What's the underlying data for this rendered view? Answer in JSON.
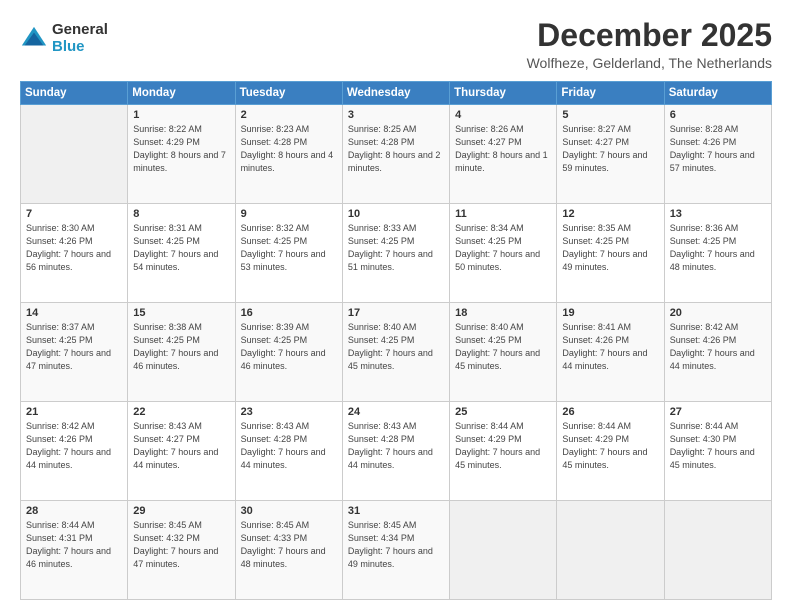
{
  "logo": {
    "general": "General",
    "blue": "Blue"
  },
  "header": {
    "month": "December 2025",
    "location": "Wolfheze, Gelderland, The Netherlands"
  },
  "weekdays": [
    "Sunday",
    "Monday",
    "Tuesday",
    "Wednesday",
    "Thursday",
    "Friday",
    "Saturday"
  ],
  "weeks": [
    [
      {
        "day": "",
        "sunrise": "",
        "sunset": "",
        "daylight": ""
      },
      {
        "day": "1",
        "sunrise": "Sunrise: 8:22 AM",
        "sunset": "Sunset: 4:29 PM",
        "daylight": "Daylight: 8 hours and 7 minutes."
      },
      {
        "day": "2",
        "sunrise": "Sunrise: 8:23 AM",
        "sunset": "Sunset: 4:28 PM",
        "daylight": "Daylight: 8 hours and 4 minutes."
      },
      {
        "day": "3",
        "sunrise": "Sunrise: 8:25 AM",
        "sunset": "Sunset: 4:28 PM",
        "daylight": "Daylight: 8 hours and 2 minutes."
      },
      {
        "day": "4",
        "sunrise": "Sunrise: 8:26 AM",
        "sunset": "Sunset: 4:27 PM",
        "daylight": "Daylight: 8 hours and 1 minute."
      },
      {
        "day": "5",
        "sunrise": "Sunrise: 8:27 AM",
        "sunset": "Sunset: 4:27 PM",
        "daylight": "Daylight: 7 hours and 59 minutes."
      },
      {
        "day": "6",
        "sunrise": "Sunrise: 8:28 AM",
        "sunset": "Sunset: 4:26 PM",
        "daylight": "Daylight: 7 hours and 57 minutes."
      }
    ],
    [
      {
        "day": "7",
        "sunrise": "Sunrise: 8:30 AM",
        "sunset": "Sunset: 4:26 PM",
        "daylight": "Daylight: 7 hours and 56 minutes."
      },
      {
        "day": "8",
        "sunrise": "Sunrise: 8:31 AM",
        "sunset": "Sunset: 4:25 PM",
        "daylight": "Daylight: 7 hours and 54 minutes."
      },
      {
        "day": "9",
        "sunrise": "Sunrise: 8:32 AM",
        "sunset": "Sunset: 4:25 PM",
        "daylight": "Daylight: 7 hours and 53 minutes."
      },
      {
        "day": "10",
        "sunrise": "Sunrise: 8:33 AM",
        "sunset": "Sunset: 4:25 PM",
        "daylight": "Daylight: 7 hours and 51 minutes."
      },
      {
        "day": "11",
        "sunrise": "Sunrise: 8:34 AM",
        "sunset": "Sunset: 4:25 PM",
        "daylight": "Daylight: 7 hours and 50 minutes."
      },
      {
        "day": "12",
        "sunrise": "Sunrise: 8:35 AM",
        "sunset": "Sunset: 4:25 PM",
        "daylight": "Daylight: 7 hours and 49 minutes."
      },
      {
        "day": "13",
        "sunrise": "Sunrise: 8:36 AM",
        "sunset": "Sunset: 4:25 PM",
        "daylight": "Daylight: 7 hours and 48 minutes."
      }
    ],
    [
      {
        "day": "14",
        "sunrise": "Sunrise: 8:37 AM",
        "sunset": "Sunset: 4:25 PM",
        "daylight": "Daylight: 7 hours and 47 minutes."
      },
      {
        "day": "15",
        "sunrise": "Sunrise: 8:38 AM",
        "sunset": "Sunset: 4:25 PM",
        "daylight": "Daylight: 7 hours and 46 minutes."
      },
      {
        "day": "16",
        "sunrise": "Sunrise: 8:39 AM",
        "sunset": "Sunset: 4:25 PM",
        "daylight": "Daylight: 7 hours and 46 minutes."
      },
      {
        "day": "17",
        "sunrise": "Sunrise: 8:40 AM",
        "sunset": "Sunset: 4:25 PM",
        "daylight": "Daylight: 7 hours and 45 minutes."
      },
      {
        "day": "18",
        "sunrise": "Sunrise: 8:40 AM",
        "sunset": "Sunset: 4:25 PM",
        "daylight": "Daylight: 7 hours and 45 minutes."
      },
      {
        "day": "19",
        "sunrise": "Sunrise: 8:41 AM",
        "sunset": "Sunset: 4:26 PM",
        "daylight": "Daylight: 7 hours and 44 minutes."
      },
      {
        "day": "20",
        "sunrise": "Sunrise: 8:42 AM",
        "sunset": "Sunset: 4:26 PM",
        "daylight": "Daylight: 7 hours and 44 minutes."
      }
    ],
    [
      {
        "day": "21",
        "sunrise": "Sunrise: 8:42 AM",
        "sunset": "Sunset: 4:26 PM",
        "daylight": "Daylight: 7 hours and 44 minutes."
      },
      {
        "day": "22",
        "sunrise": "Sunrise: 8:43 AM",
        "sunset": "Sunset: 4:27 PM",
        "daylight": "Daylight: 7 hours and 44 minutes."
      },
      {
        "day": "23",
        "sunrise": "Sunrise: 8:43 AM",
        "sunset": "Sunset: 4:28 PM",
        "daylight": "Daylight: 7 hours and 44 minutes."
      },
      {
        "day": "24",
        "sunrise": "Sunrise: 8:43 AM",
        "sunset": "Sunset: 4:28 PM",
        "daylight": "Daylight: 7 hours and 44 minutes."
      },
      {
        "day": "25",
        "sunrise": "Sunrise: 8:44 AM",
        "sunset": "Sunset: 4:29 PM",
        "daylight": "Daylight: 7 hours and 45 minutes."
      },
      {
        "day": "26",
        "sunrise": "Sunrise: 8:44 AM",
        "sunset": "Sunset: 4:29 PM",
        "daylight": "Daylight: 7 hours and 45 minutes."
      },
      {
        "day": "27",
        "sunrise": "Sunrise: 8:44 AM",
        "sunset": "Sunset: 4:30 PM",
        "daylight": "Daylight: 7 hours and 45 minutes."
      }
    ],
    [
      {
        "day": "28",
        "sunrise": "Sunrise: 8:44 AM",
        "sunset": "Sunset: 4:31 PM",
        "daylight": "Daylight: 7 hours and 46 minutes."
      },
      {
        "day": "29",
        "sunrise": "Sunrise: 8:45 AM",
        "sunset": "Sunset: 4:32 PM",
        "daylight": "Daylight: 7 hours and 47 minutes."
      },
      {
        "day": "30",
        "sunrise": "Sunrise: 8:45 AM",
        "sunset": "Sunset: 4:33 PM",
        "daylight": "Daylight: 7 hours and 48 minutes."
      },
      {
        "day": "31",
        "sunrise": "Sunrise: 8:45 AM",
        "sunset": "Sunset: 4:34 PM",
        "daylight": "Daylight: 7 hours and 49 minutes."
      },
      {
        "day": "",
        "sunrise": "",
        "sunset": "",
        "daylight": ""
      },
      {
        "day": "",
        "sunrise": "",
        "sunset": "",
        "daylight": ""
      },
      {
        "day": "",
        "sunrise": "",
        "sunset": "",
        "daylight": ""
      }
    ]
  ]
}
